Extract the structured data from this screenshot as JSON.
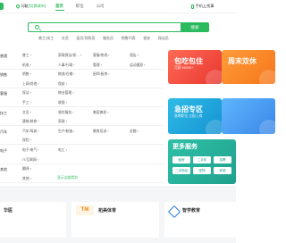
{
  "header": {
    "location": "马鞍",
    "switch_city": "[切换城市]",
    "nav": [
      "首页",
      "职位",
      "公司"
    ],
    "login": "手机上找事"
  },
  "search": {
    "placeholder": "",
    "button": "搜索",
    "hot": [
      "普工/技工",
      "文员",
      "促员/导购员",
      "服务员",
      "销售代表",
      "保安",
      "保洁员"
    ]
  },
  "categories": [
    {
      "head": "普通",
      "cols": [
        "普工 ›",
        "家政保洁/保… ›",
        "客服/热线 ›",
        "酒店 ›"
      ]
    },
    {
      "head": "",
      "cols": [
        "机电 ›",
        "人事/行政 ›",
        "管理 ›",
        "运动健身 ›"
      ]
    },
    {
      "head": "销售",
      "cols": [
        "销售 ›",
        "物流/仓储 ›",
        "厨师/厨房 ›",
        ""
      ]
    },
    {
      "head": "",
      "cols": [
        "上网/其他 ›",
        "保安 ›",
        "",
        ""
      ]
    },
    {
      "head": "客服",
      "cols": [
        "保洁 ›",
        "物业管理 ›",
        "",
        ""
      ]
    },
    {
      "head": "",
      "cols": [
        "手工 ›",
        "收银 ›",
        "",
        ""
      ]
    },
    {
      "head": "技工",
      "cols": [
        "文员 ›",
        "餐饮服务 ›",
        "美容美发 ›",
        ""
      ]
    },
    {
      "head": "",
      "cols": [
        "建筑/装修 ›",
        "家政 ›",
        "",
        ""
      ]
    },
    {
      "head": "汽车",
      "cols": [
        "汽车/驾驶 ›",
        "生产/制造 ›",
        "教育培训 ›",
        "金融 ›"
      ]
    },
    {
      "head": "",
      "cols": [
        "保险 ›",
        "",
        "",
        ""
      ]
    },
    {
      "head": "电子",
      "cols": [
        "电子/电气 ›",
        "电工 ›",
        "",
        ""
      ]
    },
    {
      "head": "",
      "cols": [
        "IT/互联网 ›",
        "",
        "",
        ""
      ]
    },
    {
      "head": "其他",
      "cols": [
        "翻译 ›",
        "",
        "",
        ""
      ]
    },
    {
      "head": "",
      "cols": [
        "其他 ›",
        "",
        "",
        ""
      ]
    }
  ],
  "more_categories": "显示全部类别",
  "promos": [
    {
      "title": "包吃包住",
      "sub": "月薪 ¥5000+"
    },
    {
      "title": "周末双休",
      "sub": ""
    },
    {
      "title": "急招专区",
      "sub": "急聘职位 立即上岗"
    },
    {
      "title": "",
      "sub": ""
    }
  ],
  "services": {
    "title": "更多服务",
    "buttons": [
      "租房",
      "二手车",
      "招聘",
      "二手物品",
      "宠物",
      "家政"
    ]
  },
  "companies": [
    {
      "name": "华医",
      "desc": "",
      "jobs": [
        ""
      ]
    },
    {
      "name": "拓美体育",
      "logo": "TM",
      "desc": "",
      "jobs": [
        ""
      ]
    },
    {
      "name": "智学教育",
      "desc": "",
      "jobs": [
        ""
      ]
    }
  ]
}
